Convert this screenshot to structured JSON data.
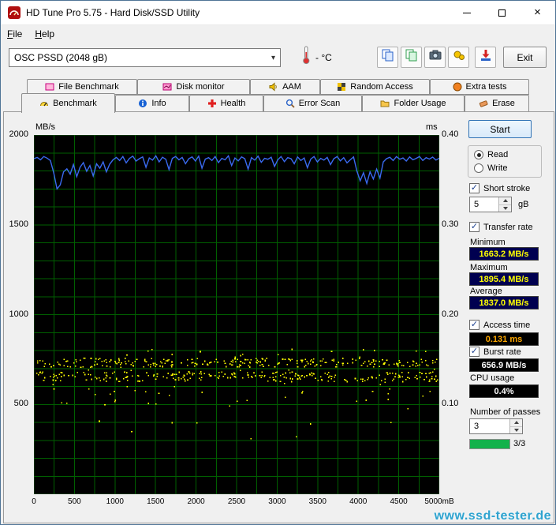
{
  "window": {
    "title": "HD Tune Pro 5.75 - Hard Disk/SSD Utility"
  },
  "menu": {
    "items": [
      {
        "label": "File"
      },
      {
        "label": "Help"
      }
    ]
  },
  "toolbar": {
    "drive_select": "OSC PSSD (2048 gB)",
    "temperature": "- °C",
    "exit_label": "Exit"
  },
  "tabs": {
    "row1": [
      {
        "label": "File Benchmark"
      },
      {
        "label": "Disk monitor"
      },
      {
        "label": "AAM"
      },
      {
        "label": "Random Access"
      },
      {
        "label": "Extra tests"
      }
    ],
    "row2": [
      {
        "label": "Benchmark",
        "active": true
      },
      {
        "label": "Info"
      },
      {
        "label": "Health"
      },
      {
        "label": "Error Scan"
      },
      {
        "label": "Folder Usage"
      },
      {
        "label": "Erase"
      }
    ]
  },
  "panel": {
    "start_label": "Start",
    "read_label": "Read",
    "write_label": "Write",
    "short_stroke_label": "Short stroke",
    "short_stroke_value": "5",
    "short_stroke_unit": "gB",
    "transfer_rate_label": "Transfer rate",
    "minimum_label": "Minimum",
    "minimum_value": "1663.2 MB/s",
    "maximum_label": "Maximum",
    "maximum_value": "1895.4 MB/s",
    "average_label": "Average",
    "average_value": "1837.0 MB/s",
    "access_time_label": "Access time",
    "access_time_value": "0.131 ms",
    "burst_rate_label": "Burst rate",
    "burst_rate_value": "656.9 MB/s",
    "cpu_usage_label": "CPU usage",
    "cpu_usage_value": "0.4%",
    "passes_label": "Number of passes",
    "passes_value": "3",
    "progress_text": "3/3",
    "progress_fraction": 1
  },
  "colors": {
    "value_box_navy": "#000050",
    "value_box_black": "#000000",
    "value_text_yellow": "#ffff00",
    "value_text_orange": "#ffa800",
    "value_text_white": "#ffffff",
    "progress_green": "#12b24b",
    "watermark_blue": "#2fa3cf"
  },
  "chart_data": {
    "type": "line+scatter",
    "title": "",
    "x_axis": {
      "min": 0,
      "max": 5000,
      "tick_values": [
        0,
        500,
        1000,
        1500,
        2000,
        2500,
        3000,
        3500,
        4000,
        4500,
        5000
      ],
      "tick_labels": [
        "0",
        "500",
        "1000",
        "1500",
        "2000",
        "2500",
        "3000",
        "3500",
        "4000",
        "4500",
        "5000mB"
      ]
    },
    "left_axis": {
      "label": "MB/s",
      "min": 0,
      "max": 2000,
      "tick_values": [
        2000,
        1500,
        1000,
        500
      ],
      "tick_labels": [
        "2000",
        "1500",
        "1000",
        "500"
      ]
    },
    "right_axis": {
      "label": "ms",
      "min": 0,
      "max": 0.4,
      "tick_values": [
        0.4,
        0.3,
        0.2,
        0.1
      ],
      "tick_labels": [
        "0.40",
        "0.30",
        "0.20",
        "0.10"
      ]
    },
    "grid": {
      "x_step": 250,
      "y_step": 100,
      "color": "#005f00"
    },
    "plot_background": "#000000",
    "series": [
      {
        "name": "transfer-rate",
        "type": "line",
        "axis": "left",
        "color": "#3a6af0",
        "x_evenly_spaced": true,
        "values": [
          1868,
          1875,
          1862,
          1880,
          1871,
          1858,
          1790,
          1700,
          1722,
          1795,
          1812,
          1782,
          1836,
          1768,
          1820,
          1846,
          1798,
          1830,
          1772,
          1840,
          1815,
          1850,
          1795,
          1838,
          1862,
          1875,
          1858,
          1880,
          1845,
          1870,
          1882,
          1855,
          1868,
          1878,
          1820,
          1872,
          1860,
          1884,
          1850,
          1876,
          1865,
          1808,
          1870,
          1880,
          1862,
          1875,
          1840,
          1868,
          1878,
          1855,
          1882,
          1815,
          1866,
          1874,
          1858,
          1880,
          1846,
          1870,
          1862,
          1884,
          1830,
          1872,
          1856,
          1878,
          1868,
          1810,
          1874,
          1860,
          1882,
          1848,
          1870,
          1865,
          1876,
          1825,
          1862,
          1880,
          1852,
          1874,
          1868,
          1840,
          1878,
          1858,
          1872,
          1818,
          1866,
          1880,
          1850,
          1870,
          1860,
          1875,
          1835,
          1868,
          1880,
          1856,
          1874,
          1845,
          1862,
          1878,
          1800,
          1745,
          1790,
          1730,
          1795,
          1755,
          1810,
          1760,
          1850,
          1868,
          1876,
          1858,
          1880,
          1865,
          1872,
          1855,
          1878,
          1862,
          1870,
          1880,
          1858,
          1874,
          1866,
          1877,
          1860,
          1871
        ]
      },
      {
        "name": "access-time",
        "type": "scatter",
        "axis": "right",
        "color": "#ffff00",
        "seed": 42,
        "bands": [
          {
            "x_min": 20,
            "x_max": 4990,
            "y_min": 0.142,
            "y_max": 0.152,
            "count": 240
          },
          {
            "x_min": 20,
            "x_max": 4990,
            "y_min": 0.126,
            "y_max": 0.137,
            "count": 240
          },
          {
            "x_min": 20,
            "x_max": 4990,
            "y_min": 0.1,
            "y_max": 0.162,
            "count": 90
          },
          {
            "x_min": 100,
            "x_max": 4900,
            "y_min": 0.06,
            "y_max": 0.1,
            "count": 10
          }
        ]
      }
    ]
  },
  "watermark": {
    "text": "www.ssd-tester.de"
  }
}
